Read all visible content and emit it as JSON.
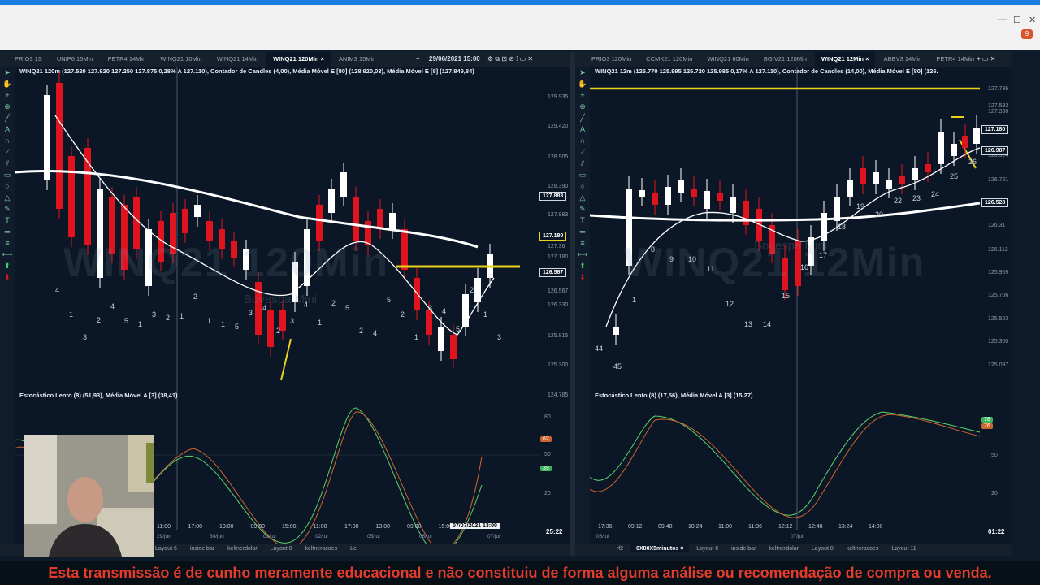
{
  "window": {
    "minimize": "—",
    "maximize": "☐",
    "close": "✕",
    "notifications": "9"
  },
  "left": {
    "tabs": [
      "PRIO3 1S",
      "UNIP6 15Min",
      "PETR4 14Min",
      "WINQ21 10Min",
      "WINQ21 14Min",
      "WINQ21 120Min ×",
      "ANIM3 15Min"
    ],
    "tab_date": "29/06/2021 15:00",
    "info": "WINQ21 120m (127.520  127.920  127.250  127.875  0,28%  A 127.110), Contador de Candles (4,00), Média Móvel E [80] (128.920,03), Média Móvel E [8] (127.849,84)",
    "watermark": "WINQ21 120Min",
    "watermark_sub": "Bovespa Mini",
    "prices": [
      "129.935",
      "129.420",
      "128.905",
      "128.390",
      "127.883",
      "127.36",
      "127.180",
      "126.567",
      "126.330",
      "125.815",
      "125.300",
      "124.785"
    ],
    "price_tags": {
      "upper": "127.883",
      "mid": "127.180",
      "lower": "126.567"
    },
    "indicator": "Estocástico Lento (8) (51,93), Média Móvel A [3] (38,41)",
    "osc_levels": [
      "80",
      "50",
      "20"
    ],
    "osc_tags": [
      "62",
      "39"
    ],
    "times": [
      "11:00",
      "17:00",
      "13:00",
      "09:00",
      "15:00",
      "11:00",
      "17:00",
      "13:00",
      "09:00",
      "15:00"
    ],
    "crosshair_date": "07/07/2021 13:00",
    "dates": [
      "29/jun",
      "30/jun",
      "01/jul",
      "02/jul",
      "05/jul",
      "06/jul",
      "07/jul"
    ],
    "clock": "25:22",
    "bottom_tabs": [
      "Layout 6",
      "inside bar",
      "keltnerdolar",
      "Layout 8",
      "keltneracoes",
      "Le"
    ],
    "candle_labels": [
      "4",
      "1",
      "3",
      "2",
      "4",
      "5",
      "1",
      "3",
      "2",
      "1",
      "2",
      "1",
      "1",
      "5",
      "3",
      "4",
      "2",
      "3",
      "4",
      "1",
      "2",
      "5",
      "2",
      "4",
      "5",
      "2",
      "1",
      "3",
      "4",
      "5",
      "2",
      "1",
      "3"
    ]
  },
  "right": {
    "tabs": [
      "PRIO3 120Min",
      "CCMK21 120Min",
      "WINQ21 60Min",
      "BGIV21 120Min",
      "WINQ21 12Min ×",
      "ABEV3 14Min",
      "PETR4 14Min"
    ],
    "info": "WINQ21 12m (125.770  125.995  125.720  125.985  0,17%  A 127.110), Contador de Candles (14,00), Média Móvel E [80] (126.",
    "watermark": "WINQ21 12Min",
    "watermark_sub": "Bovespa Mini",
    "prices": [
      "127.736",
      "127.533",
      "127.330",
      "127.180",
      "126.987",
      "126.924",
      "126.721",
      "126.528",
      "126.31",
      "126.112",
      "125.909",
      "125.706",
      "125.503",
      "125.300",
      "125.097"
    ],
    "price_tags": {
      "top": "127.180",
      "mid": "126.987",
      "lower": "126.528"
    },
    "indicator": "Estocástico Lento (8) (17,56), Média Móvel A [3] (15,27)",
    "osc_levels": [
      "50",
      "20"
    ],
    "osc_tags": [
      "78",
      "76"
    ],
    "times": [
      "17:36",
      "09:12",
      "09:48",
      "10:24",
      "11:00",
      "11:36",
      "12:12",
      "12:48",
      "13:24",
      "14:00"
    ],
    "dates": [
      "06/jul",
      "07/jul"
    ],
    "clock": "01:22",
    "bottom_tabs": [
      "rf2",
      "8X80X5minutos ×",
      "Layout 6",
      "inside bar",
      "keltnerdolar",
      "Layout 8",
      "keltneracoes",
      "Layout 11"
    ],
    "candle_labels": [
      "44",
      "45",
      "1",
      "8",
      "9",
      "10",
      "11",
      "12",
      "13",
      "14",
      "15",
      "16",
      "17",
      "18",
      "19",
      "20",
      "22",
      "23",
      "24",
      "25",
      "26"
    ]
  },
  "caption": "Esta transmissão é de cunho meramente educacional e não constituiu de forma alguma análise ou recomendação de compra ou venda.",
  "colors": {
    "bull": "#ffffff",
    "bear": "#e0141e",
    "ema": "#ffffff",
    "line_yellow": "#e8d21a",
    "stoch_k": "#5cd16b",
    "stoch_d": "#d0642e",
    "bg": "#0b1726"
  }
}
